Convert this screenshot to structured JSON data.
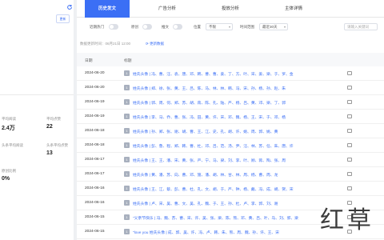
{
  "left": {
    "pill_label": "更新",
    "stats": [
      {
        "label": "平均阅读",
        "value": "2.4万"
      },
      {
        "label": "平均点赞",
        "value": "22"
      },
      {
        "label": "头条平均阅读",
        "value": ""
      },
      {
        "label": "头条平均点赞",
        "value": "13"
      },
      {
        "label": "原创比例",
        "value": "0%"
      }
    ]
  },
  "tabs": [
    {
      "label": "历史发文",
      "active": true
    },
    {
      "label": "广告分析",
      "active": false
    },
    {
      "label": "投放分析",
      "active": false
    },
    {
      "label": "主体详情",
      "active": false
    }
  ],
  "filters": {
    "hot_label": "近期热门",
    "original_label": "原创",
    "headline_label": "推文",
    "position_label": "位置",
    "position_value": "不限",
    "time_label": "时间范围",
    "time_value": "最近30天",
    "search_placeholder": "请输入关键词"
  },
  "updated_text": "数据更新时间：06月21日 12:00",
  "update_link": "更新数据",
  "table": {
    "headers": [
      "日期",
      "标题"
    ],
    "rows": [
      {
        "date": "2024-06-20",
        "num": "1",
        "title": "姓氏头像 | 冯、曹、汪、袁、唐、邓、韩、曹、曹、姜、丁、方、叶、宋、姜、梁、于、罗、金"
      },
      {
        "date": "2024-06-20",
        "num": "1",
        "title": "姓氏头像 | 郑、徐、张、黄、王、吕、陈、马、林、林、韩、冯、宋、孙、杨、孙、赵、朱"
      },
      {
        "date": "2024-06-19",
        "num": "1",
        "title": "姓氏头像 | 郭、周、何、郑、苏、胡、蒋、陈、孔、陆、严、杨、吕、黄、邓、梁、丁、郭"
      },
      {
        "date": "2024-06-19",
        "num": "1",
        "title": "姓氏头像 | 李、马、乔、曹、张、冯、田、黄、许、宋、邓、魏、杨、王、宋、于、邓、杨"
      },
      {
        "date": "2024-06-18",
        "num": "1",
        "title": "姓氏头像 | 孙、郑、张、谢、胡、曹、王、江、史、孔、胡、许、姚、周、郭、姚、黄"
      },
      {
        "date": "2024-06-18",
        "num": "1",
        "title": "姓氏头像 | 彭、鲁、程、郑、韩、曹、杜、邓、吕、范、汤、尹、汪、林、苏、任、朱、唐、许"
      },
      {
        "date": "2024-06-17",
        "num": "1",
        "title": "姓氏头像 | 王、王、潘、宋、黄、张、严、宁、马、梁、刘、李、叶、顾、蒋、陶、张、周"
      },
      {
        "date": "2024-06-17",
        "num": "1",
        "title": "姓氏头像 | 黄、潘、苏、向、曹、邓、施、潘、胡、林、甘、林、周、杨、曹、周、龙"
      },
      {
        "date": "2024-06-16",
        "num": "1",
        "title": "姓氏头像 | 王、江、蔡、彭、曹、杜、孔、文、胡、于、严、钟、杨、戴、冯、成、胡、贺、宋"
      },
      {
        "date": "2024-06-16",
        "num": "1",
        "title": "姓氏头像 | 卢、宋、吴、曹、文、吴、孔、魏、于、王、孙、杜、卢、李、郭、刘、谢"
      },
      {
        "date": "2024-06-15",
        "num": "1",
        "title": "“父亲节快乐 | 冯、魏、苏、曹、宋、许、吴、张、梁、陈、熊、邓、黄、吕、叶、马、刘、郭、梁"
      },
      {
        "date": "2024-06-15",
        "num": "1",
        "title": "“love you 姓氏头像 | 成、郭、吴、许、冯、卢、韩、朱、熊、周、魏、孙、许、王、宋"
      }
    ]
  },
  "watermark": "红草"
}
